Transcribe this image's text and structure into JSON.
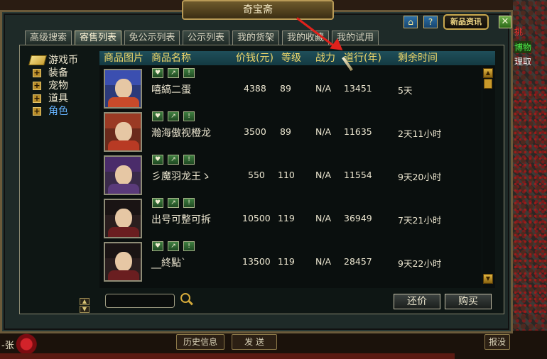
{
  "window": {
    "title": "奇宝斋",
    "help_icon": "?",
    "home_icon": "⌂",
    "news_button": "新品资讯",
    "close_icon": "✕"
  },
  "tabs": [
    "高级搜索",
    "寄售列表",
    "免公示列表",
    "公示列表",
    "我的货架",
    "我的收藏",
    "我的试用"
  ],
  "active_tab": "寄售列表",
  "tree": [
    {
      "label": "游戏币",
      "icon": "gold-ingot-icon"
    },
    {
      "label": "装备",
      "icon": "plus-icon"
    },
    {
      "label": "宠物",
      "icon": "plus-icon"
    },
    {
      "label": "道具",
      "icon": "plus-icon"
    },
    {
      "label": "角色",
      "icon": "plus-icon"
    }
  ],
  "table": {
    "headers": [
      "商品图片",
      "商品名称",
      "价钱(元)",
      "等级",
      "战力",
      "道行(年)",
      "剩余时间"
    ],
    "rows": [
      {
        "name": "嘻縞二蛋",
        "price": "4388",
        "level": "89",
        "power": "N/A",
        "daoxing": "13451",
        "remaining": "5天",
        "portrait": "blue-hair-boy"
      },
      {
        "name": "瀚海傲视橙龙",
        "price": "3500",
        "level": "89",
        "power": "N/A",
        "daoxing": "11635",
        "remaining": "2天11小时",
        "portrait": "red-hair-girl"
      },
      {
        "name": "彡魔羽龙王ゝ",
        "price": "550",
        "level": "110",
        "power": "N/A",
        "daoxing": "11554",
        "remaining": "9天20小时",
        "portrait": "purple-hair-man"
      },
      {
        "name": "出号可整可拆",
        "price": "10500",
        "level": "119",
        "power": "N/A",
        "daoxing": "36949",
        "remaining": "7天21小时",
        "portrait": "dark-hair-woman"
      },
      {
        "name": "__終點ˋ",
        "price": "13500",
        "level": "119",
        "power": "N/A",
        "daoxing": "28457",
        "remaining": "9天22小时",
        "portrait": "dark-hair-woman"
      }
    ],
    "row_actions": [
      "♥",
      "↗",
      "!"
    ]
  },
  "search": {
    "value": "",
    "placeholder": ""
  },
  "buttons": {
    "counter_offer": "还价",
    "buy": "购买"
  },
  "background": {
    "right_labels": [
      "挑",
      "博物",
      "理取"
    ],
    "bottom_left": "-张",
    "bottom_buttons": [
      "历史信息",
      "发 送",
      "报没"
    ]
  },
  "colors": {
    "header_text": "#f0d86a",
    "selected_tree": "#66b3ff",
    "arrow": "#e0221c"
  }
}
